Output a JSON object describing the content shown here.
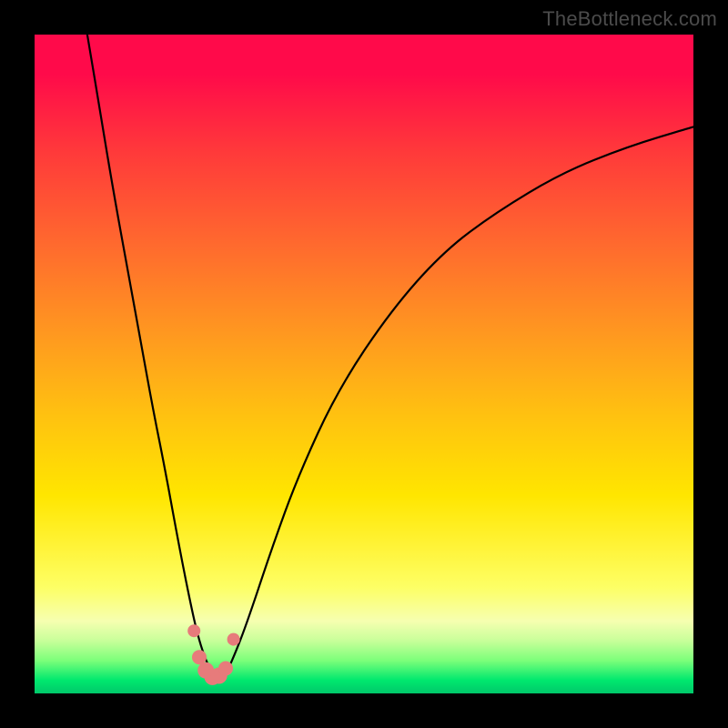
{
  "attribution": "TheBottleneck.com",
  "colors": {
    "frame_bg": "#000000",
    "gradient_top": "#ff0a4a",
    "gradient_bottom": "#00c86a",
    "curve_stroke": "#000000",
    "marker_fill": "#e77b7b",
    "marker_stroke": "#b55"
  },
  "chart_data": {
    "type": "line",
    "title": "",
    "xlabel": "",
    "ylabel": "",
    "xlim": [
      0,
      100
    ],
    "ylim": [
      0,
      100
    ],
    "series": [
      {
        "name": "bottleneck-curve",
        "x": [
          8,
          10,
          12,
          14,
          16,
          18,
          20,
          22,
          24,
          25,
          26,
          27,
          28,
          29,
          30,
          32,
          36,
          40,
          46,
          54,
          62,
          70,
          80,
          90,
          100
        ],
        "y": [
          100,
          88,
          76,
          65,
          54,
          43,
          33,
          22,
          12,
          8,
          5,
          3,
          2,
          3,
          5,
          10,
          22,
          33,
          46,
          58,
          67,
          73,
          79,
          83,
          86
        ]
      }
    ],
    "markers": {
      "name": "highlight-dots",
      "x": [
        24.2,
        25.0,
        26.0,
        27.0,
        28.0,
        29.0,
        30.2
      ],
      "y": [
        9.5,
        5.5,
        3.5,
        2.5,
        2.7,
        3.8,
        8.2
      ],
      "r": [
        7,
        8,
        9,
        9,
        9,
        8,
        7
      ]
    }
  }
}
